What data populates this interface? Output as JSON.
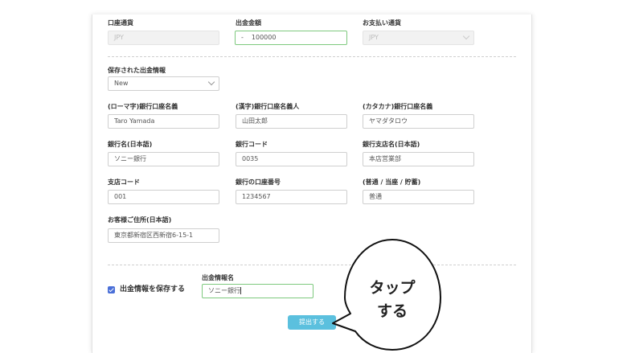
{
  "row1": {
    "currency_label": "口座通貨",
    "currency_value": "JPY",
    "amount_label": "出金金額",
    "amount_prefix": "-",
    "amount_value": "100000",
    "pay_currency_label": "お支払い通貨",
    "pay_currency_value": "JPY"
  },
  "saved": {
    "label": "保存された出金情報",
    "value": "New"
  },
  "row3": {
    "roman_name_label": "(ローマ字)銀行口座名義",
    "roman_name_value": "Taro Yamada",
    "kanji_name_label": "(漢字)銀行口座名義人",
    "kanji_name_value": "山田太郎",
    "kana_name_label": "(カタカナ)銀行口座名義",
    "kana_name_value": "ヤマダタロウ"
  },
  "row4": {
    "bank_name_label": "銀行名(日本語)",
    "bank_name_value": "ソニー銀行",
    "bank_code_label": "銀行コード",
    "bank_code_value": "0035",
    "branch_name_label": "銀行支店名(日本語)",
    "branch_name_value": "本店営業部"
  },
  "row5": {
    "branch_code_label": "支店コード",
    "branch_code_value": "001",
    "account_number_label": "銀行の口座番号",
    "account_number_value": "1234567",
    "account_type_label": "(普通 / 当座 / 貯蓄)",
    "account_type_value": "普通"
  },
  "address": {
    "label": "お客様ご住所(日本語)",
    "value": "東京都新宿区西新宿6-15-1"
  },
  "save": {
    "checkbox_label": "出金情報を保存する",
    "name_label": "出金情報名",
    "name_value": "ソニー銀行"
  },
  "submit_label": "提出する",
  "callout": {
    "line1": "タップ",
    "line2": "する"
  },
  "colors": {
    "submit": "#5bc0de",
    "checkbox": "#4a6fd8",
    "focus_border": "#7ec97e"
  }
}
